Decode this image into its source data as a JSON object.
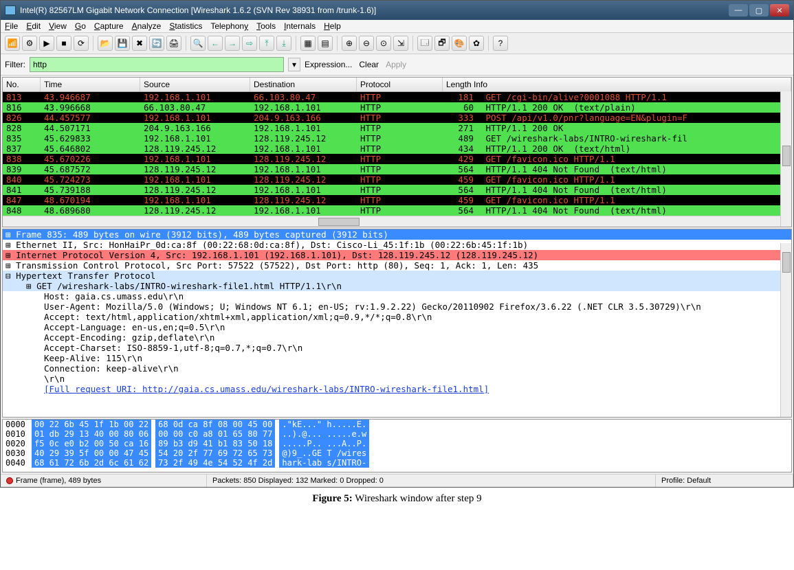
{
  "title": "Intel(R) 82567LM Gigabit Network Connection   [Wireshark 1.6.2  (SVN Rev 38931 from /trunk-1.6)]",
  "menu": [
    "File",
    "Edit",
    "View",
    "Go",
    "Capture",
    "Analyze",
    "Statistics",
    "Telephony",
    "Tools",
    "Internals",
    "Help"
  ],
  "filter": {
    "label": "Filter:",
    "value": "http",
    "expression": "Expression...",
    "clear": "Clear",
    "apply": "Apply"
  },
  "columns": {
    "no": "No.",
    "time": "Time",
    "source": "Source",
    "destination": "Destination",
    "protocol": "Protocol",
    "length_info": "Length  Info"
  },
  "packets": [
    {
      "cls": "black",
      "no": "813",
      "time": "43.946687",
      "src": "192.168.1.101",
      "dst": "66.103.80.47",
      "proto": "HTTP",
      "len": "181",
      "info": "GET /cgi-bin/alive?0001088 HTTP/1.1"
    },
    {
      "cls": "green",
      "no": "816",
      "time": "43.996668",
      "src": "66.103.80.47",
      "dst": "192.168.1.101",
      "proto": "HTTP",
      "len": "60",
      "info": "HTTP/1.1 200 OK  (text/plain)"
    },
    {
      "cls": "black",
      "no": "826",
      "time": "44.457577",
      "src": "192.168.1.101",
      "dst": "204.9.163.166",
      "proto": "HTTP",
      "len": "333",
      "info": "POST /api/v1.0/pnr?language=EN&plugin=F"
    },
    {
      "cls": "green",
      "no": "828",
      "time": "44.507171",
      "src": "204.9.163.166",
      "dst": "192.168.1.101",
      "proto": "HTTP",
      "len": "271",
      "info": "HTTP/1.1 200 OK"
    },
    {
      "cls": "green",
      "no": "835",
      "time": "45.629833",
      "src": "192.168.1.101",
      "dst": "128.119.245.12",
      "proto": "HTTP",
      "len": "489",
      "info": "GET /wireshark-labs/INTRO-wireshark-fil"
    },
    {
      "cls": "green",
      "no": "837",
      "time": "45.646802",
      "src": "128.119.245.12",
      "dst": "192.168.1.101",
      "proto": "HTTP",
      "len": "434",
      "info": "HTTP/1.1 200 OK  (text/html)"
    },
    {
      "cls": "black",
      "no": "838",
      "time": "45.670226",
      "src": "192.168.1.101",
      "dst": "128.119.245.12",
      "proto": "HTTP",
      "len": "429",
      "info": "GET /favicon.ico HTTP/1.1"
    },
    {
      "cls": "green",
      "no": "839",
      "time": "45.687572",
      "src": "128.119.245.12",
      "dst": "192.168.1.101",
      "proto": "HTTP",
      "len": "564",
      "info": "HTTP/1.1 404 Not Found  (text/html)"
    },
    {
      "cls": "black",
      "no": "840",
      "time": "45.724273",
      "src": "192.168.1.101",
      "dst": "128.119.245.12",
      "proto": "HTTP",
      "len": "459",
      "info": "GET /favicon.ico HTTP/1.1"
    },
    {
      "cls": "green",
      "no": "841",
      "time": "45.739188",
      "src": "128.119.245.12",
      "dst": "192.168.1.101",
      "proto": "HTTP",
      "len": "564",
      "info": "HTTP/1.1 404 Not Found  (text/html)"
    },
    {
      "cls": "black",
      "no": "847",
      "time": "48.670194",
      "src": "192.168.1.101",
      "dst": "128.119.245.12",
      "proto": "HTTP",
      "len": "459",
      "info": "GET /favicon.ico HTTP/1.1"
    },
    {
      "cls": "green",
      "no": "848",
      "time": "48.689680",
      "src": "128.119.245.12",
      "dst": "192.168.1.101",
      "proto": "HTTP",
      "len": "564",
      "info": "HTTP/1.1 404 Not Found  (text/html)"
    }
  ],
  "details": {
    "frame": "Frame 835: 489 bytes on wire (3912 bits), 489 bytes captured (3912 bits)",
    "eth": "Ethernet II, Src: HonHaiPr_0d:ca:8f (00:22:68:0d:ca:8f), Dst: Cisco-Li_45:1f:1b (00:22:6b:45:1f:1b)",
    "ip": "Internet Protocol Version 4, Src: 192.168.1.101 (192.168.1.101), Dst: 128.119.245.12 (128.119.245.12)",
    "tcp": "Transmission Control Protocol, Src Port: 57522 (57522), Dst Port: http (80), Seq: 1, Ack: 1, Len: 435",
    "http": "Hypertext Transfer Protocol",
    "get": "GET /wireshark-labs/INTRO-wireshark-file1.html HTTP/1.1\\r\\n",
    "h1": "Host: gaia.cs.umass.edu\\r\\n",
    "h2": "User-Agent: Mozilla/5.0 (Windows; U; Windows NT 6.1; en-US; rv:1.9.2.22) Gecko/20110902 Firefox/3.6.22 (.NET CLR 3.5.30729)\\r\\n",
    "h3": "Accept: text/html,application/xhtml+xml,application/xml;q=0.9,*/*;q=0.8\\r\\n",
    "h4": "Accept-Language: en-us,en;q=0.5\\r\\n",
    "h5": "Accept-Encoding: gzip,deflate\\r\\n",
    "h6": "Accept-Charset: ISO-8859-1,utf-8;q=0.7,*;q=0.7\\r\\n",
    "h7": "Keep-Alive: 115\\r\\n",
    "h8": "Connection: keep-alive\\r\\n",
    "h9": "\\r\\n",
    "uri": "[Full request URI: http://gaia.cs.umass.edu/wireshark-labs/INTRO-wireshark-file1.html]"
  },
  "hex": [
    {
      "off": "0000",
      "b1": "00 22 6b 45 1f 1b 00 22",
      "b2": "68 0d ca 8f 08 00 45 00",
      "a": ".\"kE...\" h.....E."
    },
    {
      "off": "0010",
      "b1": "01 db 29 13 40 00 80 06",
      "b2": "00 00 c0 a8 01 65 80 77",
      "a": "..).@... .....e.w"
    },
    {
      "off": "0020",
      "b1": "f5 0c e0 b2 00 50 ca 16",
      "b2": "89 b3 d9 41 b1 83 50 18",
      "a": ".....P.. ...A..P."
    },
    {
      "off": "0030",
      "b1": "40 29 39 5f 00 00 47 45",
      "b2": "54 20 2f 77 69 72 65 73",
      "a": "@)9_..GE T /wires"
    },
    {
      "off": "0040",
      "b1": "68 61 72 6b 2d 6c 61 62",
      "b2": "73 2f 49 4e 54 52 4f 2d",
      "a": "hark-lab s/INTRO-"
    }
  ],
  "status": {
    "left": "Frame (frame), 489 bytes",
    "mid": "Packets: 850 Displayed: 132 Marked: 0 Dropped: 0",
    "right": "Profile: Default"
  },
  "caption": "Figure 5: Wireshark window after step 9"
}
